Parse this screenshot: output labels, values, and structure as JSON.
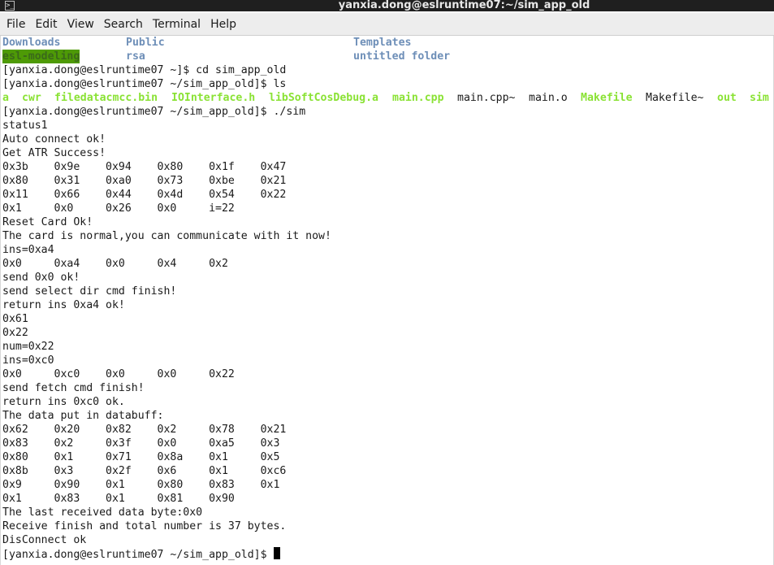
{
  "window": {
    "title": "yanxia.dong@eslruntime07:~/sim_app_old"
  },
  "menu": [
    "File",
    "Edit",
    "View",
    "Search",
    "Terminal",
    "Help"
  ],
  "colors": {
    "directory": "#6e8fb8",
    "directory_highlight_bg": "#4e9a06",
    "executable": "#8ae234",
    "text": "#1a1a1a",
    "background": "#ffffff"
  },
  "listing": {
    "row1": [
      "Downloads",
      "Public",
      "Templates"
    ],
    "row2": [
      "esl-modeling",
      "rsa",
      "untitled folder"
    ]
  },
  "commands": {
    "prompt_home": "[yanxia.dong@eslruntime07 ~]$ cd sim_app_old",
    "prompt_ls": "[yanxia.dong@eslruntime07 ~/sim_app_old]$ ls",
    "prompt_run": "[yanxia.dong@eslruntime07 ~/sim_app_old]$ ./sim",
    "prompt_final": "[yanxia.dong@eslruntime07 ~/sim_app_old]$ "
  },
  "ls_output": [
    {
      "name": "a",
      "kind": "exe"
    },
    {
      "name": "cwr",
      "kind": "exe"
    },
    {
      "name": "filedatacmcc.bin",
      "kind": "exe"
    },
    {
      "name": "IOInterface.h",
      "kind": "exe"
    },
    {
      "name": "libSoftCosDebug.a",
      "kind": "exe"
    },
    {
      "name": "main.cpp",
      "kind": "exe"
    },
    {
      "name": "main.cpp~",
      "kind": "plain"
    },
    {
      "name": "main.o",
      "kind": "plain"
    },
    {
      "name": "Makefile",
      "kind": "exe"
    },
    {
      "name": "Makefile~",
      "kind": "plain"
    },
    {
      "name": "out",
      "kind": "exe"
    },
    {
      "name": "sim",
      "kind": "exe"
    }
  ],
  "output": [
    "status1",
    "Auto connect ok!",
    "Get ATR Success!",
    "0x3b    0x9e    0x94    0x80    0x1f    0x47",
    "0x80    0x31    0xa0    0x73    0xbe    0x21",
    "0x11    0x66    0x44    0x4d    0x54    0x22",
    "0x1     0x0     0x26    0x0     i=22",
    "Reset Card Ok!",
    "The card is normal,you can communicate with it now!",
    "ins=0xa4",
    "0x0     0xa4    0x0     0x4     0x2",
    "send 0x0 ok!",
    "send select dir cmd finish!",
    "return ins 0xa4 ok!",
    "0x61",
    "0x22",
    "num=0x22",
    "ins=0xc0",
    "0x0     0xc0    0x0     0x0     0x22",
    "send fetch cmd finish!",
    "return ins 0xc0 ok.",
    "The data put in databuff:",
    "0x62    0x20    0x82    0x2     0x78    0x21",
    "0x83    0x2     0x3f    0x0     0xa5    0x3",
    "0x80    0x1     0x71    0x8a    0x1     0x5",
    "0x8b    0x3     0x2f    0x6     0x1     0xc6",
    "0x9     0x90    0x1     0x80    0x83    0x1",
    "0x1     0x83    0x1     0x81    0x90",
    "The last received data byte:0x0",
    "Receive finish and total number is 37 bytes.",
    "DisConnect ok"
  ]
}
